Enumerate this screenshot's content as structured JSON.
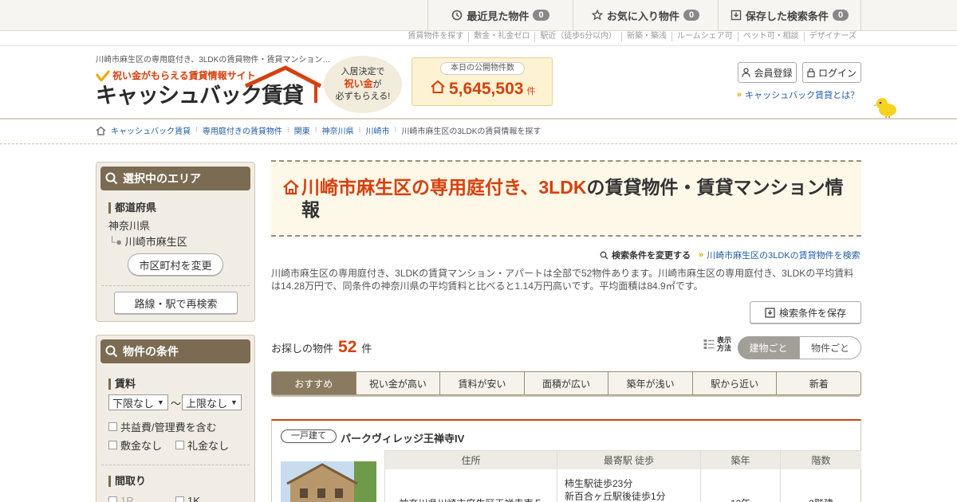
{
  "topbar": {
    "recent": {
      "label": "最近見た物件",
      "count": "0"
    },
    "favorites": {
      "label": "お気に入り物件",
      "count": "0"
    },
    "saved": {
      "label": "保存した検索条件",
      "count": "0"
    }
  },
  "sublinks": [
    "賃貸物件を探す",
    "敷金・礼金ゼロ",
    "駅近（徒歩5分以内）",
    "新築・築浅",
    "ルームシェア可",
    "ペット可・相談",
    "デザイナーズ"
  ],
  "header": {
    "site_desc": "川崎市麻生区の専用庭付き、3LDKの賃貸物件・賃貸マンション…",
    "logo_tagline": "祝い金がもらえる賃貸情報サイト",
    "logo_name": "キャッシュバック賃貸",
    "bubble": {
      "line1": "入居決定で",
      "line2": "祝い金",
      "line2b": "が",
      "line3": "必ずもらえる!"
    },
    "count_label": "本日の公開物件数",
    "count_value": "5,645,503",
    "count_unit": "件",
    "register_label": "会員登録",
    "login_label": "ログイン",
    "about_label": "キャッシュバック賃貸とは？",
    "colors": {
      "accent": "#d6400f",
      "brand_brown": "#7a6b52",
      "link": "#1f5aa6"
    }
  },
  "breadcrumb": [
    "キャッシュバック賃貸",
    "専用庭付きの賃貸物件",
    "関東",
    "神奈川県",
    "川崎市",
    "川崎市麻生区の3LDKの賃貸情報を探す"
  ],
  "sidebar": {
    "area": {
      "title": "選択中のエリア",
      "pref_heading": "都道府県",
      "pref": "神奈川県",
      "city": "川崎市麻生区",
      "change_city": "市区町村を変更",
      "rail_search": "路線・駅で再検索"
    },
    "conditions": {
      "title": "物件の条件",
      "rent_heading": "賃料",
      "rent_min": "下限なし",
      "rent_tilde": "〜",
      "rent_max": "上限なし",
      "include_fees": "共益費/管理費を含む",
      "no_deposit": "敷金なし",
      "no_key_money": "礼金なし",
      "layout_heading": "間取り",
      "layout_1r": "1R",
      "layout_1k": "1K"
    }
  },
  "main": {
    "title_hl": "川崎市麻生区の専用庭付き、3LDK",
    "title_rest": "の賃貸物件・賃貸マンション情報",
    "change_conditions": "検索条件を変更する",
    "search_link": "川崎市麻生区の3LDKの賃貸物件を検索",
    "description": "川崎市麻生区の専用庭付き、3LDKの賃貸マンション・アパートは全部で52物件あります。川崎市麻生区の専用庭付き、3LDKの平均賃料は14.28万円で、同条件の神奈川県の平均賃料と比べると1.14万円高いです。平均面積は84.9㎡です。",
    "save_search": "検索条件を保存",
    "results_label": "お探しの物件",
    "results_count": "52",
    "results_unit": "件",
    "view_label_1": "表示",
    "view_label_2": "方法",
    "view_by_building": "建物ごと",
    "view_by_property": "物件ごと",
    "sort_tabs": [
      "おすすめ",
      "祝い金が高い",
      "賃料が安い",
      "面積が広い",
      "築年が浅い",
      "駅から近い",
      "新着"
    ],
    "listing": {
      "type": "一戸建て",
      "name": "パークヴィレッジ王禅寺IV",
      "headers": [
        "住所",
        "最寄駅 徒歩",
        "築年",
        "階数"
      ],
      "address": "神奈川県川崎市麻生区王禅寺東５",
      "station_1": "柿生駅徒歩23分",
      "station_2": "新百合ヶ丘駅後徒歩1分",
      "age": "12年",
      "floors": "2階建"
    }
  }
}
